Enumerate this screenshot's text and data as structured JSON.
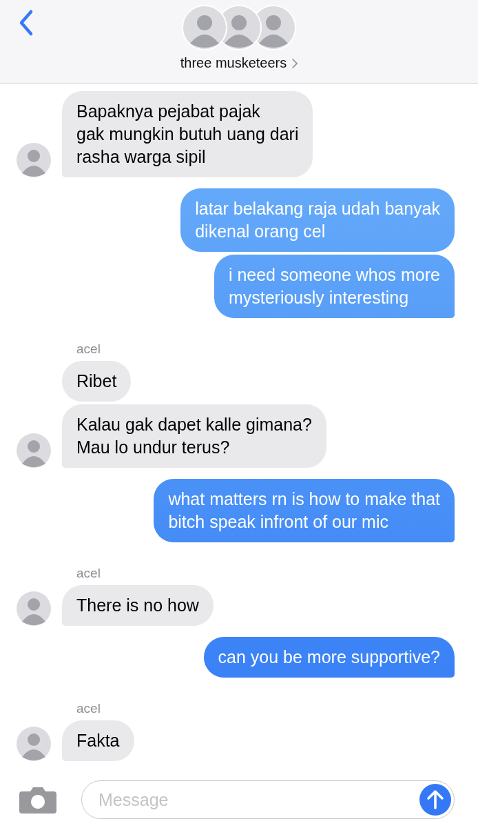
{
  "header": {
    "title": "three musketeers"
  },
  "messages": [
    {
      "kind": "incoming",
      "text": "Bapaknya pejabat pajak\ngak mungkin butuh uang dari\nrasha warga sipil",
      "tail": true
    },
    {
      "kind": "outgoing",
      "text": "latar belakang raja udah banyak\ndikenal orang cel",
      "tail": false
    },
    {
      "kind": "outgoing",
      "text": "i need someone whos more\nmysteriously interesting",
      "tail": true
    },
    {
      "kind": "sender",
      "text": "acel"
    },
    {
      "kind": "incoming",
      "text": "Ribet",
      "tail": false
    },
    {
      "kind": "incoming",
      "text": "Kalau gak dapet kalle gimana?\nMau lo undur terus?",
      "tail": true
    },
    {
      "kind": "outgoing",
      "text": "what matters rn is how to make that\nbitch speak infront of our mic",
      "tail": true
    },
    {
      "kind": "sender",
      "text": "acel"
    },
    {
      "kind": "incoming",
      "text": "There is no how",
      "tail": true
    },
    {
      "kind": "outgoing",
      "text": "can you be more supportive?",
      "tail": true
    },
    {
      "kind": "sender",
      "text": "acel"
    },
    {
      "kind": "incoming",
      "text": "Fakta",
      "tail": true
    }
  ],
  "composer": {
    "placeholder": "Message"
  }
}
